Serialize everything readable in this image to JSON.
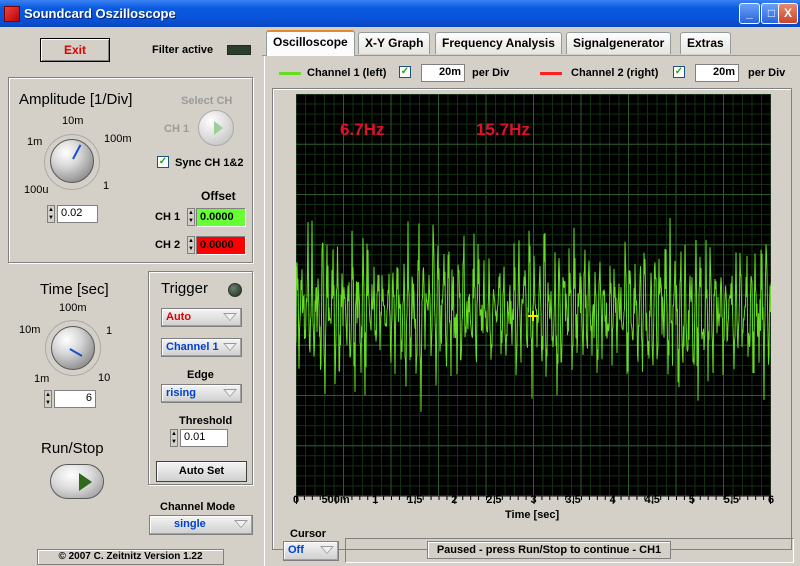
{
  "window": {
    "title": "Soundcard Oszilloscope",
    "minimize": "_",
    "maximize": "□",
    "close": "X"
  },
  "left": {
    "exit_label": "Exit",
    "filter_label": "Filter active",
    "amplitude": {
      "title": "Amplitude [1/Div]",
      "labels": [
        "1m",
        "10m",
        "100m",
        "100u",
        "1"
      ],
      "value": "0.02"
    },
    "select_ch": {
      "title": "Select CH",
      "label": "CH 1"
    },
    "sync_label": "Sync CH 1&2",
    "sync_checked": "✓",
    "offset": {
      "title": "Offset",
      "ch1_label": "CH 1",
      "ch1_value": "0.0000",
      "ch2_label": "CH 2",
      "ch2_value": "0.0000",
      "ch1_color": "#66ff33",
      "ch2_color": "#ff0000"
    },
    "time": {
      "title": "Time [sec]",
      "labels": [
        "100m",
        "10m",
        "1",
        "1m",
        "10"
      ],
      "value": "6"
    },
    "run_stop_label": "Run/Stop",
    "channel_mode": {
      "title": "Channel Mode",
      "value": "single"
    },
    "copyright": "© 2007  C. Zeitnitz Version 1.22"
  },
  "trigger": {
    "title": "Trigger",
    "mode": "Auto",
    "channel": "Channel 1",
    "edge_label": "Edge",
    "edge": "rising",
    "threshold_label": "Threshold",
    "threshold": "0.01",
    "autoset_label": "Auto Set"
  },
  "tabs": [
    {
      "label": "Oscilloscope"
    },
    {
      "label": "X-Y Graph"
    },
    {
      "label": "Frequency Analysis"
    },
    {
      "label": "Signalgenerator"
    },
    {
      "label": "Extras"
    }
  ],
  "channels": {
    "ch1_label": "Channel 1 (left)",
    "ch1_div": "20m",
    "ch1_color": "#66dd22",
    "per_div": "per Div",
    "ch2_label": "Channel 2 (right)",
    "ch2_div": "20m",
    "ch2_color": "#ff2020",
    "checked": "✓"
  },
  "plot": {
    "freq1": "6.7Hz",
    "freq2": "15.7Hz",
    "freq_color": "#e0102a",
    "xlabel": "Time [sec]",
    "xticks": [
      "0",
      "500m",
      "1",
      "1.5",
      "2",
      "2.5",
      "3",
      "3.5",
      "4",
      "4.5",
      "5",
      "5.5",
      "6"
    ]
  },
  "chart_data": {
    "type": "line",
    "xlabel": "Time [sec]",
    "xlim": [
      0,
      6
    ],
    "x_ticks": [
      "0",
      "500m",
      "1",
      "1.5",
      "2",
      "2.5",
      "3",
      "3.5",
      "4",
      "4.5",
      "5",
      "5.5",
      "6"
    ],
    "grid": true,
    "series": [
      {
        "name": "Channel 1 (left)",
        "color": "#66dd22"
      }
    ],
    "annotations": [
      "6.7Hz",
      "15.7Hz"
    ]
  },
  "bottom": {
    "cursor_title": "Cursor",
    "cursor_value": "Off",
    "status": "Paused - press Run/Stop to continue - CH1"
  }
}
